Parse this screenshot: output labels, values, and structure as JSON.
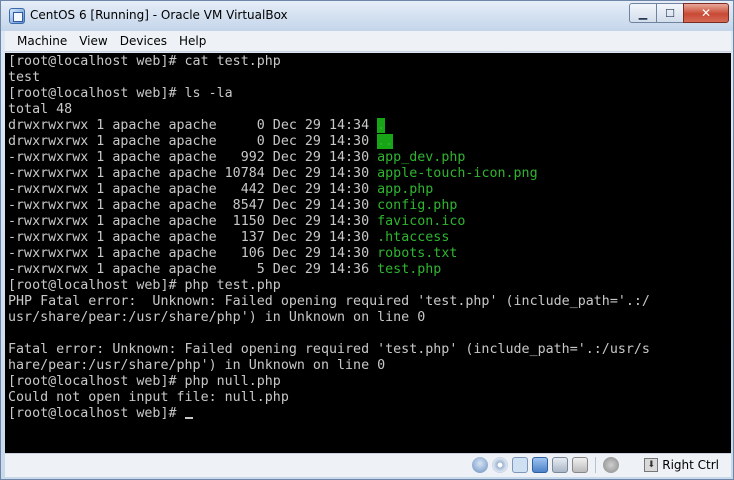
{
  "window": {
    "title": "CentOS 6 [Running] - Oracle VM VirtualBox",
    "minimize_glyph": "▁",
    "maximize_glyph": "☐",
    "close_glyph": "✕"
  },
  "menu": {
    "items": [
      {
        "label": "Machine"
      },
      {
        "label": "View"
      },
      {
        "label": "Devices"
      },
      {
        "label": "Help"
      }
    ]
  },
  "terminal": {
    "lines": [
      {
        "text": "[root@localhost web]# cat test.php"
      },
      {
        "text": "test"
      },
      {
        "text": "[root@localhost web]# ls -la"
      },
      {
        "text": "total 48"
      },
      {
        "prefix": "drwxrwxrwx 1 apache apache     0 Dec 29 14:34 ",
        "name": ".",
        "kind": "dir"
      },
      {
        "prefix": "drwxrwxrwx 1 apache apache     0 Dec 29 14:30 ",
        "name": "..",
        "kind": "dir"
      },
      {
        "prefix": "-rwxrwxrwx 1 apache apache   992 Dec 29 14:30 ",
        "name": "app_dev.php",
        "kind": "file"
      },
      {
        "prefix": "-rwxrwxrwx 1 apache apache 10784 Dec 29 14:30 ",
        "name": "apple-touch-icon.png",
        "kind": "file"
      },
      {
        "prefix": "-rwxrwxrwx 1 apache apache   442 Dec 29 14:30 ",
        "name": "app.php",
        "kind": "file"
      },
      {
        "prefix": "-rwxrwxrwx 1 apache apache  8547 Dec 29 14:30 ",
        "name": "config.php",
        "kind": "file"
      },
      {
        "prefix": "-rwxrwxrwx 1 apache apache  1150 Dec 29 14:30 ",
        "name": "favicon.ico",
        "kind": "file"
      },
      {
        "prefix": "-rwxrwxrwx 1 apache apache   137 Dec 29 14:30 ",
        "name": ".htaccess",
        "kind": "file"
      },
      {
        "prefix": "-rwxrwxrwx 1 apache apache   106 Dec 29 14:30 ",
        "name": "robots.txt",
        "kind": "file"
      },
      {
        "prefix": "-rwxrwxrwx 1 apache apache     5 Dec 29 14:36 ",
        "name": "test.php",
        "kind": "file"
      },
      {
        "text": "[root@localhost web]# php test.php"
      },
      {
        "text": "PHP Fatal error:  Unknown: Failed opening required 'test.php' (include_path='.:/"
      },
      {
        "text": "usr/share/pear:/usr/share/php') in Unknown on line 0"
      },
      {
        "text": ""
      },
      {
        "text": "Fatal error: Unknown: Failed opening required 'test.php' (include_path='.:/usr/s"
      },
      {
        "text": "hare/pear:/usr/share/php') in Unknown on line 0"
      },
      {
        "text": "[root@localhost web]# php null.php"
      },
      {
        "text": "Could not open input file: null.php"
      },
      {
        "text": "[root@localhost web]# ",
        "cursor": true
      }
    ]
  },
  "statusbar": {
    "icons": [
      "hard-disk-icon",
      "optical-drive-icon",
      "usb-icon",
      "shared-folder-icon",
      "network-icon",
      "recording-icon",
      "mouse-integration-icon",
      "keyboard-capture-icon"
    ],
    "host_key_label": "Right Ctrl"
  },
  "colors": {
    "terminal_bg": "#000000",
    "terminal_fg": "#c8c8c8",
    "terminal_file": "#2fb52f",
    "dir_highlight": "#17a517"
  }
}
